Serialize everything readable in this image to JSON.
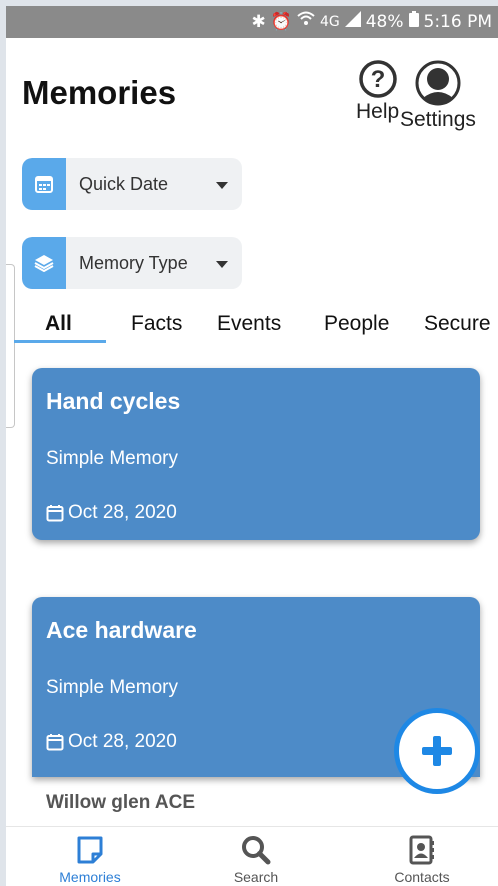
{
  "status_bar": {
    "network": "4G",
    "battery": "48%",
    "time": "5:16 PM"
  },
  "header": {
    "title": "Memories",
    "help_label": "Help",
    "settings_label": "Settings"
  },
  "filters": {
    "quick_date": "Quick Date",
    "memory_type": "Memory Type"
  },
  "tabs": [
    "All",
    "Facts",
    "Events",
    "People",
    "Secure"
  ],
  "cards": [
    {
      "title": "Hand cycles",
      "type": "Simple Memory",
      "date": "Oct 28, 2020"
    },
    {
      "title": "Ace hardware",
      "type": "Simple Memory",
      "date": "Oct 28, 2020",
      "note": "Willow glen ACE"
    }
  ],
  "bottom_nav": {
    "memories": "Memories",
    "search": "Search",
    "contacts": "Contacts"
  },
  "colors": {
    "accent": "#5aa9ea",
    "card": "#4d8bc8",
    "fab": "#1e88e5",
    "status_bar": "#8a8a8a"
  }
}
